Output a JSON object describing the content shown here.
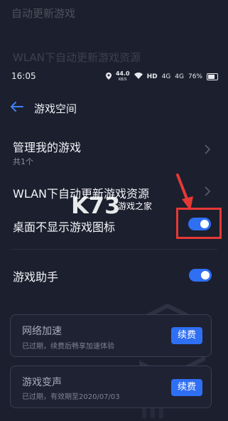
{
  "background_text": {
    "line1": "自动更新游戏",
    "line2": "WLAN下自动更新游戏资源"
  },
  "status_bar": {
    "time": "16:05",
    "net_speed": "44.0",
    "net_unit": "KB/S",
    "hd": "HD",
    "signal1": "4G",
    "signal2": "4G",
    "battery": "76%"
  },
  "header": {
    "title": "游戏空间"
  },
  "items": {
    "manage_games": {
      "title": "管理我的游戏",
      "sub": "共1个"
    },
    "wlan_update": {
      "title": "WLAN下自动更新游戏资源"
    },
    "hide_icon": {
      "title": "桌面不显示游戏图标",
      "toggle_on": true
    },
    "assistant": {
      "title": "游戏助手",
      "toggle_on": true
    }
  },
  "watermark": {
    "brand": "K73",
    "sub": "游戏之家"
  },
  "cards": [
    {
      "title": "网络加速",
      "sub": "已过期，续费后畅享加速体验",
      "button": "续费"
    },
    {
      "title": "游戏变声",
      "sub": "已过期，有效期至2020/07/03",
      "button": "续费"
    }
  ],
  "colors": {
    "background": "#1c1f2e",
    "accent": "#2f6ff3",
    "highlight": "#e53935"
  }
}
